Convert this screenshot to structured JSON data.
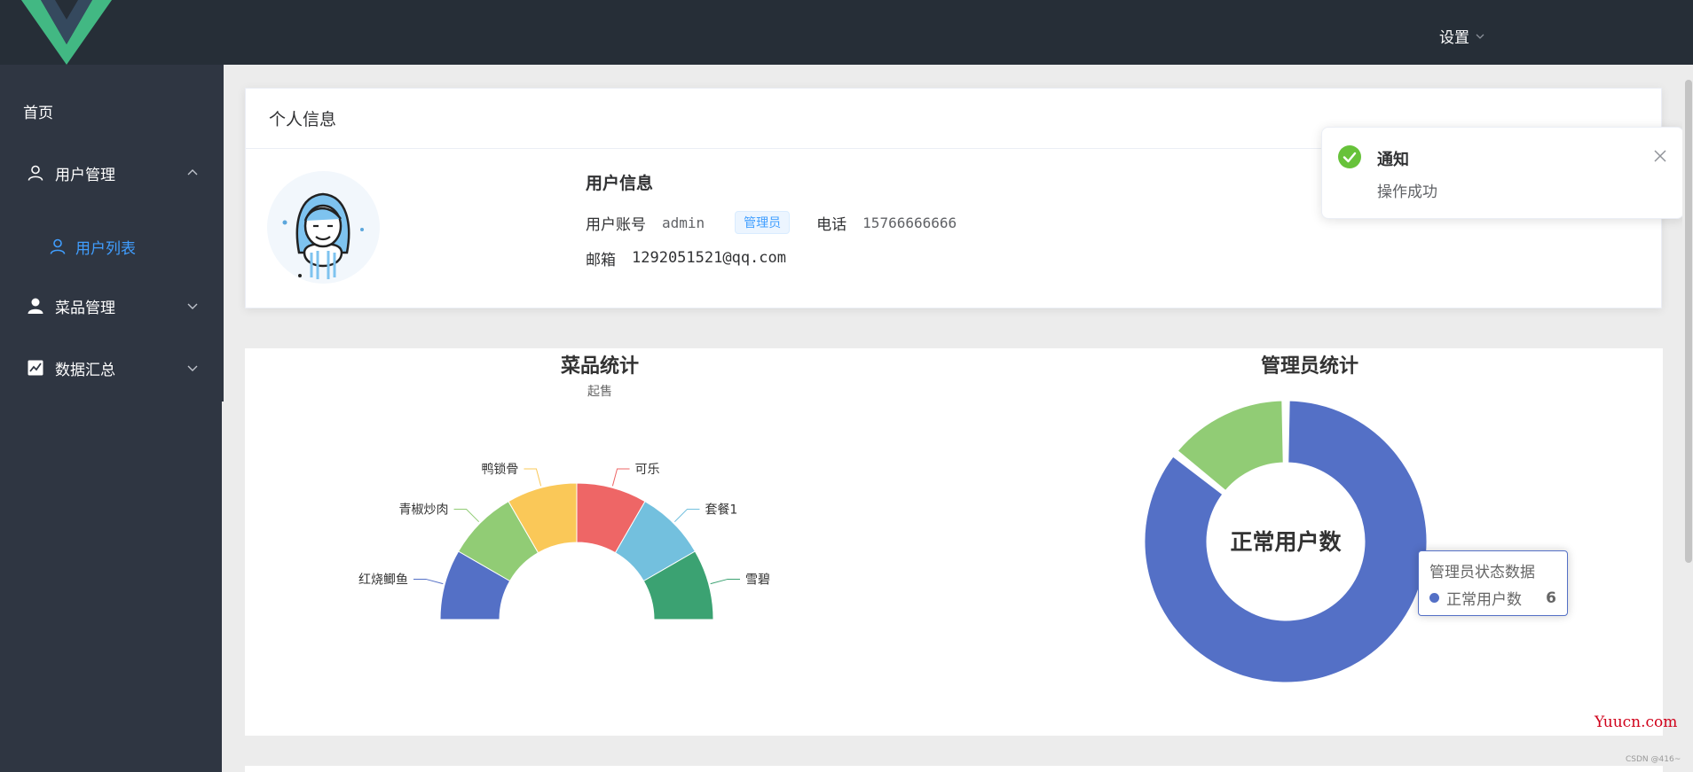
{
  "header": {
    "settings_label": "设置"
  },
  "sidebar": {
    "items": [
      {
        "label": "首页"
      },
      {
        "label": "用户管理"
      },
      {
        "label": "用户列表"
      },
      {
        "label": "菜品管理"
      },
      {
        "label": "数据汇总"
      }
    ]
  },
  "info_card": {
    "header": "个人信息",
    "title": "用户信息",
    "account_label": "用户账号",
    "account_value": "admin",
    "role_badge": "管理员",
    "phone_label": "电话",
    "phone_value": "15766666666",
    "email_label": "邮箱",
    "email_value": "1292051521@qq.com"
  },
  "notification": {
    "title": "通知",
    "message": "操作成功"
  },
  "chart_data": [
    {
      "type": "pie",
      "title": "菜品统计",
      "subtitle": "起售",
      "layout": "half-donut",
      "categories": [
        "红烧鲫鱼",
        "青椒炒肉",
        "鸭锁骨",
        "可乐",
        "套餐1",
        "雪碧"
      ],
      "values": [
        1,
        1,
        1,
        1,
        1,
        1
      ],
      "colors": [
        "#5470c6",
        "#91cc75",
        "#fac858",
        "#ee6666",
        "#73c0de",
        "#3ba272"
      ]
    },
    {
      "type": "pie",
      "title": "管理员统计",
      "layout": "donut",
      "center_label": "正常用户数",
      "categories": [
        "正常用户数",
        ""
      ],
      "values": [
        6,
        1
      ],
      "colors": [
        "#5470c6",
        "#91cc75"
      ],
      "tooltip": {
        "title": "管理员状态数据",
        "series_label": "正常用户数",
        "value": "6"
      }
    }
  ],
  "watermark": "Yuucn.com",
  "credit": "CSDN @416~"
}
